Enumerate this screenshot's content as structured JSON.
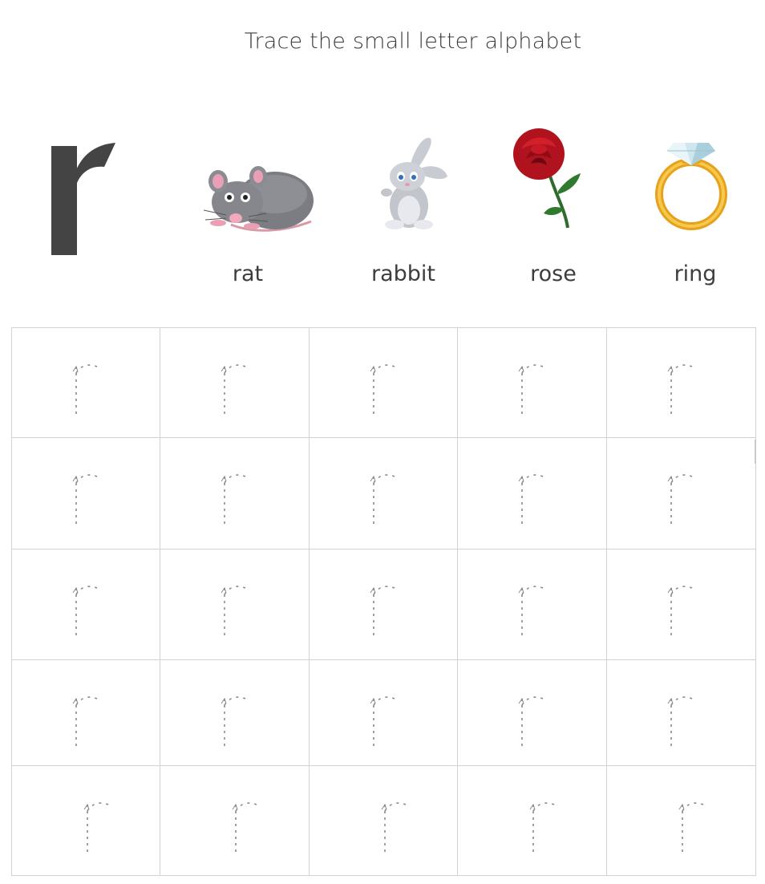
{
  "worksheet": {
    "title": "Trace the small letter alphabet",
    "letter": "r",
    "pictures": [
      {
        "word": "rat",
        "icon": "rat-icon"
      },
      {
        "word": "rabbit",
        "icon": "rabbit-icon"
      },
      {
        "word": "rose",
        "icon": "rose-icon"
      },
      {
        "word": "ring",
        "icon": "ring-icon"
      }
    ],
    "tracing_grid": {
      "rows": 5,
      "columns": 5,
      "trace_letter": "r"
    }
  },
  "colors": {
    "letter": "#444444",
    "grid_line": "#d2d2d2",
    "trace_dots": "#8a8a8a",
    "text": "#3d3d3d"
  }
}
